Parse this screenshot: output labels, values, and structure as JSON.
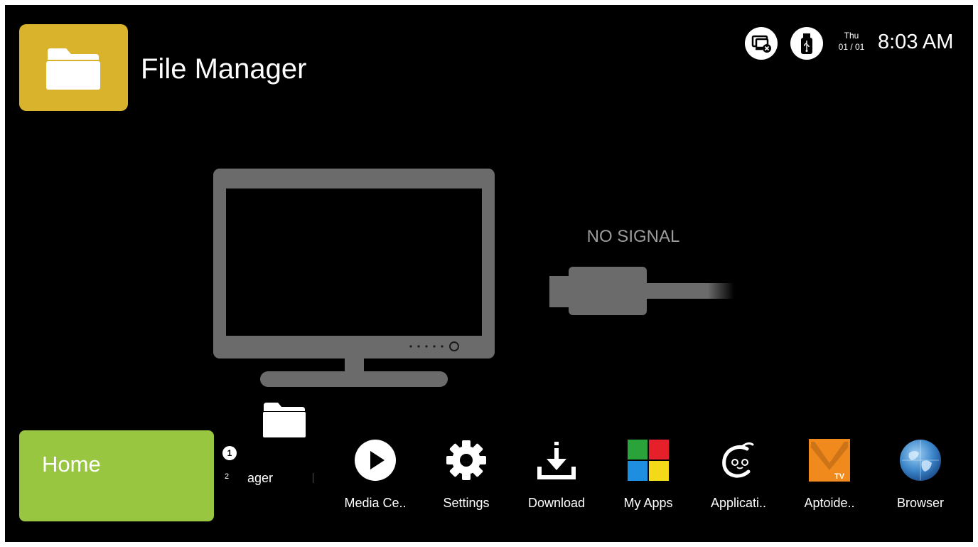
{
  "app": {
    "title": "File Manager"
  },
  "status": {
    "day": "Thu",
    "date": "01 / 01",
    "time": "8:03 AM",
    "icons": [
      "network-disconnected-icon",
      "usb-icon"
    ]
  },
  "signal": {
    "message": "NO SIGNAL"
  },
  "home": {
    "label": "Home"
  },
  "row": {
    "badge": "1",
    "page": "2",
    "partial_label": "nager"
  },
  "dock": [
    {
      "label": "Media Ce..",
      "icon": "media-center-icon"
    },
    {
      "label": "Settings",
      "icon": "settings-icon"
    },
    {
      "label": "Download",
      "icon": "download-icon"
    },
    {
      "label": "My Apps",
      "icon": "my-apps-icon"
    },
    {
      "label": "Applicati..",
      "icon": "applications-icon"
    },
    {
      "label": "Aptoide..",
      "icon": "aptoide-icon"
    },
    {
      "label": "Browser",
      "icon": "browser-icon"
    }
  ],
  "colors": {
    "accent_folder": "#dab32c",
    "home_tile": "#98c641",
    "background": "#000000",
    "illustration": "#6b6b6b",
    "aptoide": "#f08a1c"
  }
}
